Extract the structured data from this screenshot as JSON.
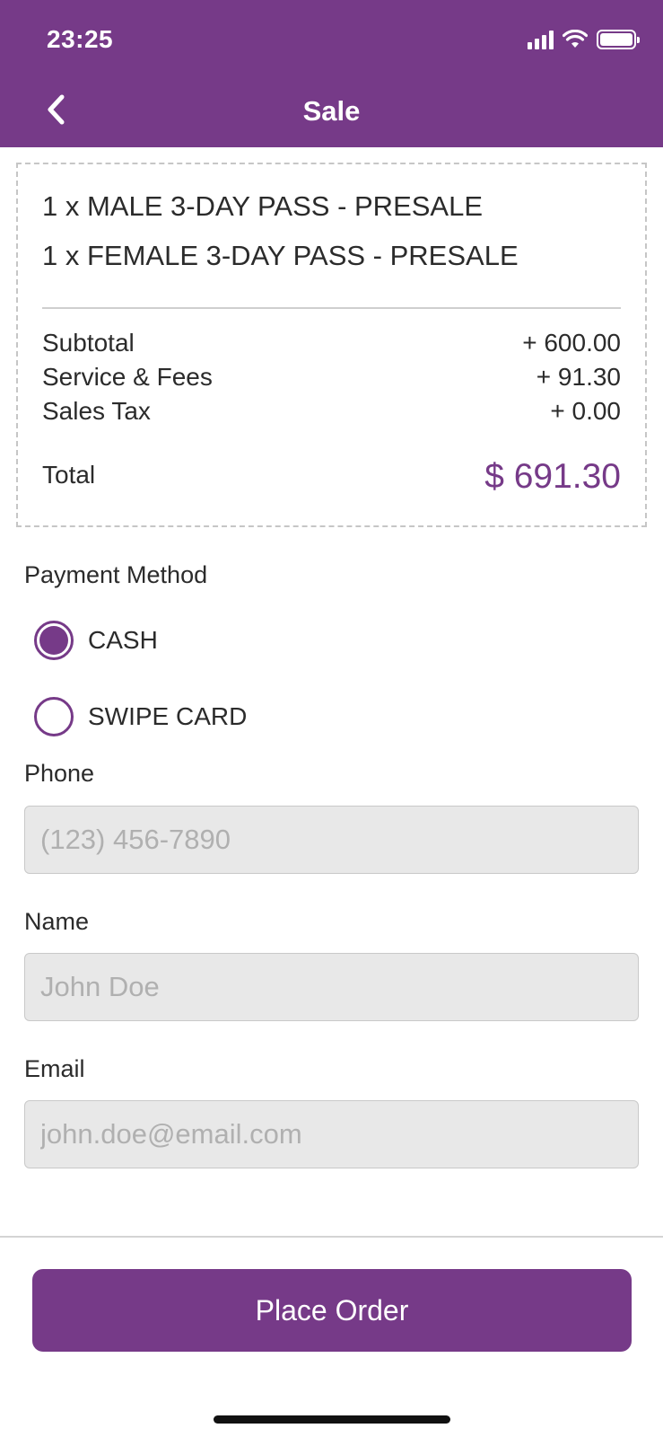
{
  "status_bar": {
    "time": "23:25"
  },
  "nav": {
    "title": "Sale",
    "back_icon": "chevron-left-icon"
  },
  "order": {
    "items": [
      "1 x MALE 3-DAY PASS - PRESALE",
      "1 x FEMALE 3-DAY PASS - PRESALE"
    ],
    "lines": [
      {
        "label": "Subtotal",
        "value": "+ 600.00"
      },
      {
        "label": "Service & Fees",
        "value": "+ 91.30"
      },
      {
        "label": "Sales Tax",
        "value": "+ 0.00"
      }
    ],
    "total_label": "Total",
    "total_value": "$ 691.30"
  },
  "payment": {
    "label": "Payment Method",
    "options": [
      {
        "label": "CASH",
        "selected": true
      },
      {
        "label": "SWIPE CARD",
        "selected": false
      }
    ]
  },
  "form": {
    "phone": {
      "label": "Phone",
      "value": "",
      "placeholder": "(123) 456-7890"
    },
    "name": {
      "label": "Name",
      "value": "",
      "placeholder": "John Doe"
    },
    "email": {
      "label": "Email",
      "value": "",
      "placeholder": "john.doe@email.com"
    }
  },
  "actions": {
    "place_order": "Place Order"
  },
  "colors": {
    "brand": "#763a88",
    "field_bg": "#e8e8e8"
  }
}
